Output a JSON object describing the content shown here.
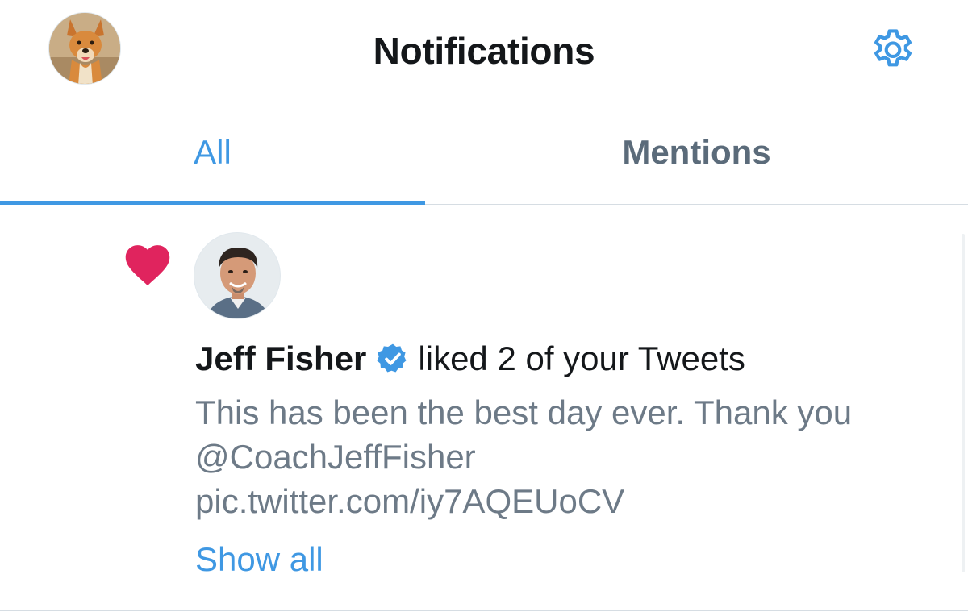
{
  "header": {
    "title": "Notifications",
    "profile_avatar_icon": "profile-avatar-dog",
    "settings_icon": "gear-icon"
  },
  "tabs": [
    {
      "label": "All",
      "active": true
    },
    {
      "label": "Mentions",
      "active": false
    }
  ],
  "notification": {
    "type_icon": "heart-icon",
    "actor_avatar_icon": "avatar-person",
    "actor_name": "Jeff Fisher",
    "verified_icon": "verified-badge-icon",
    "action_text": "liked 2 of your Tweets",
    "tweet_text": "This has been the best day ever. Thank you @CoachJeffFisher pic.twitter.com/iy7AQEUoCV",
    "show_all_label": "Show all"
  },
  "colors": {
    "accent": "#3f98e3",
    "heart": "#e0245e",
    "text_primary": "#14171a",
    "text_secondary": "#6d7a87",
    "tab_inactive": "#5b6b7a",
    "divider": "#d6dde3"
  }
}
